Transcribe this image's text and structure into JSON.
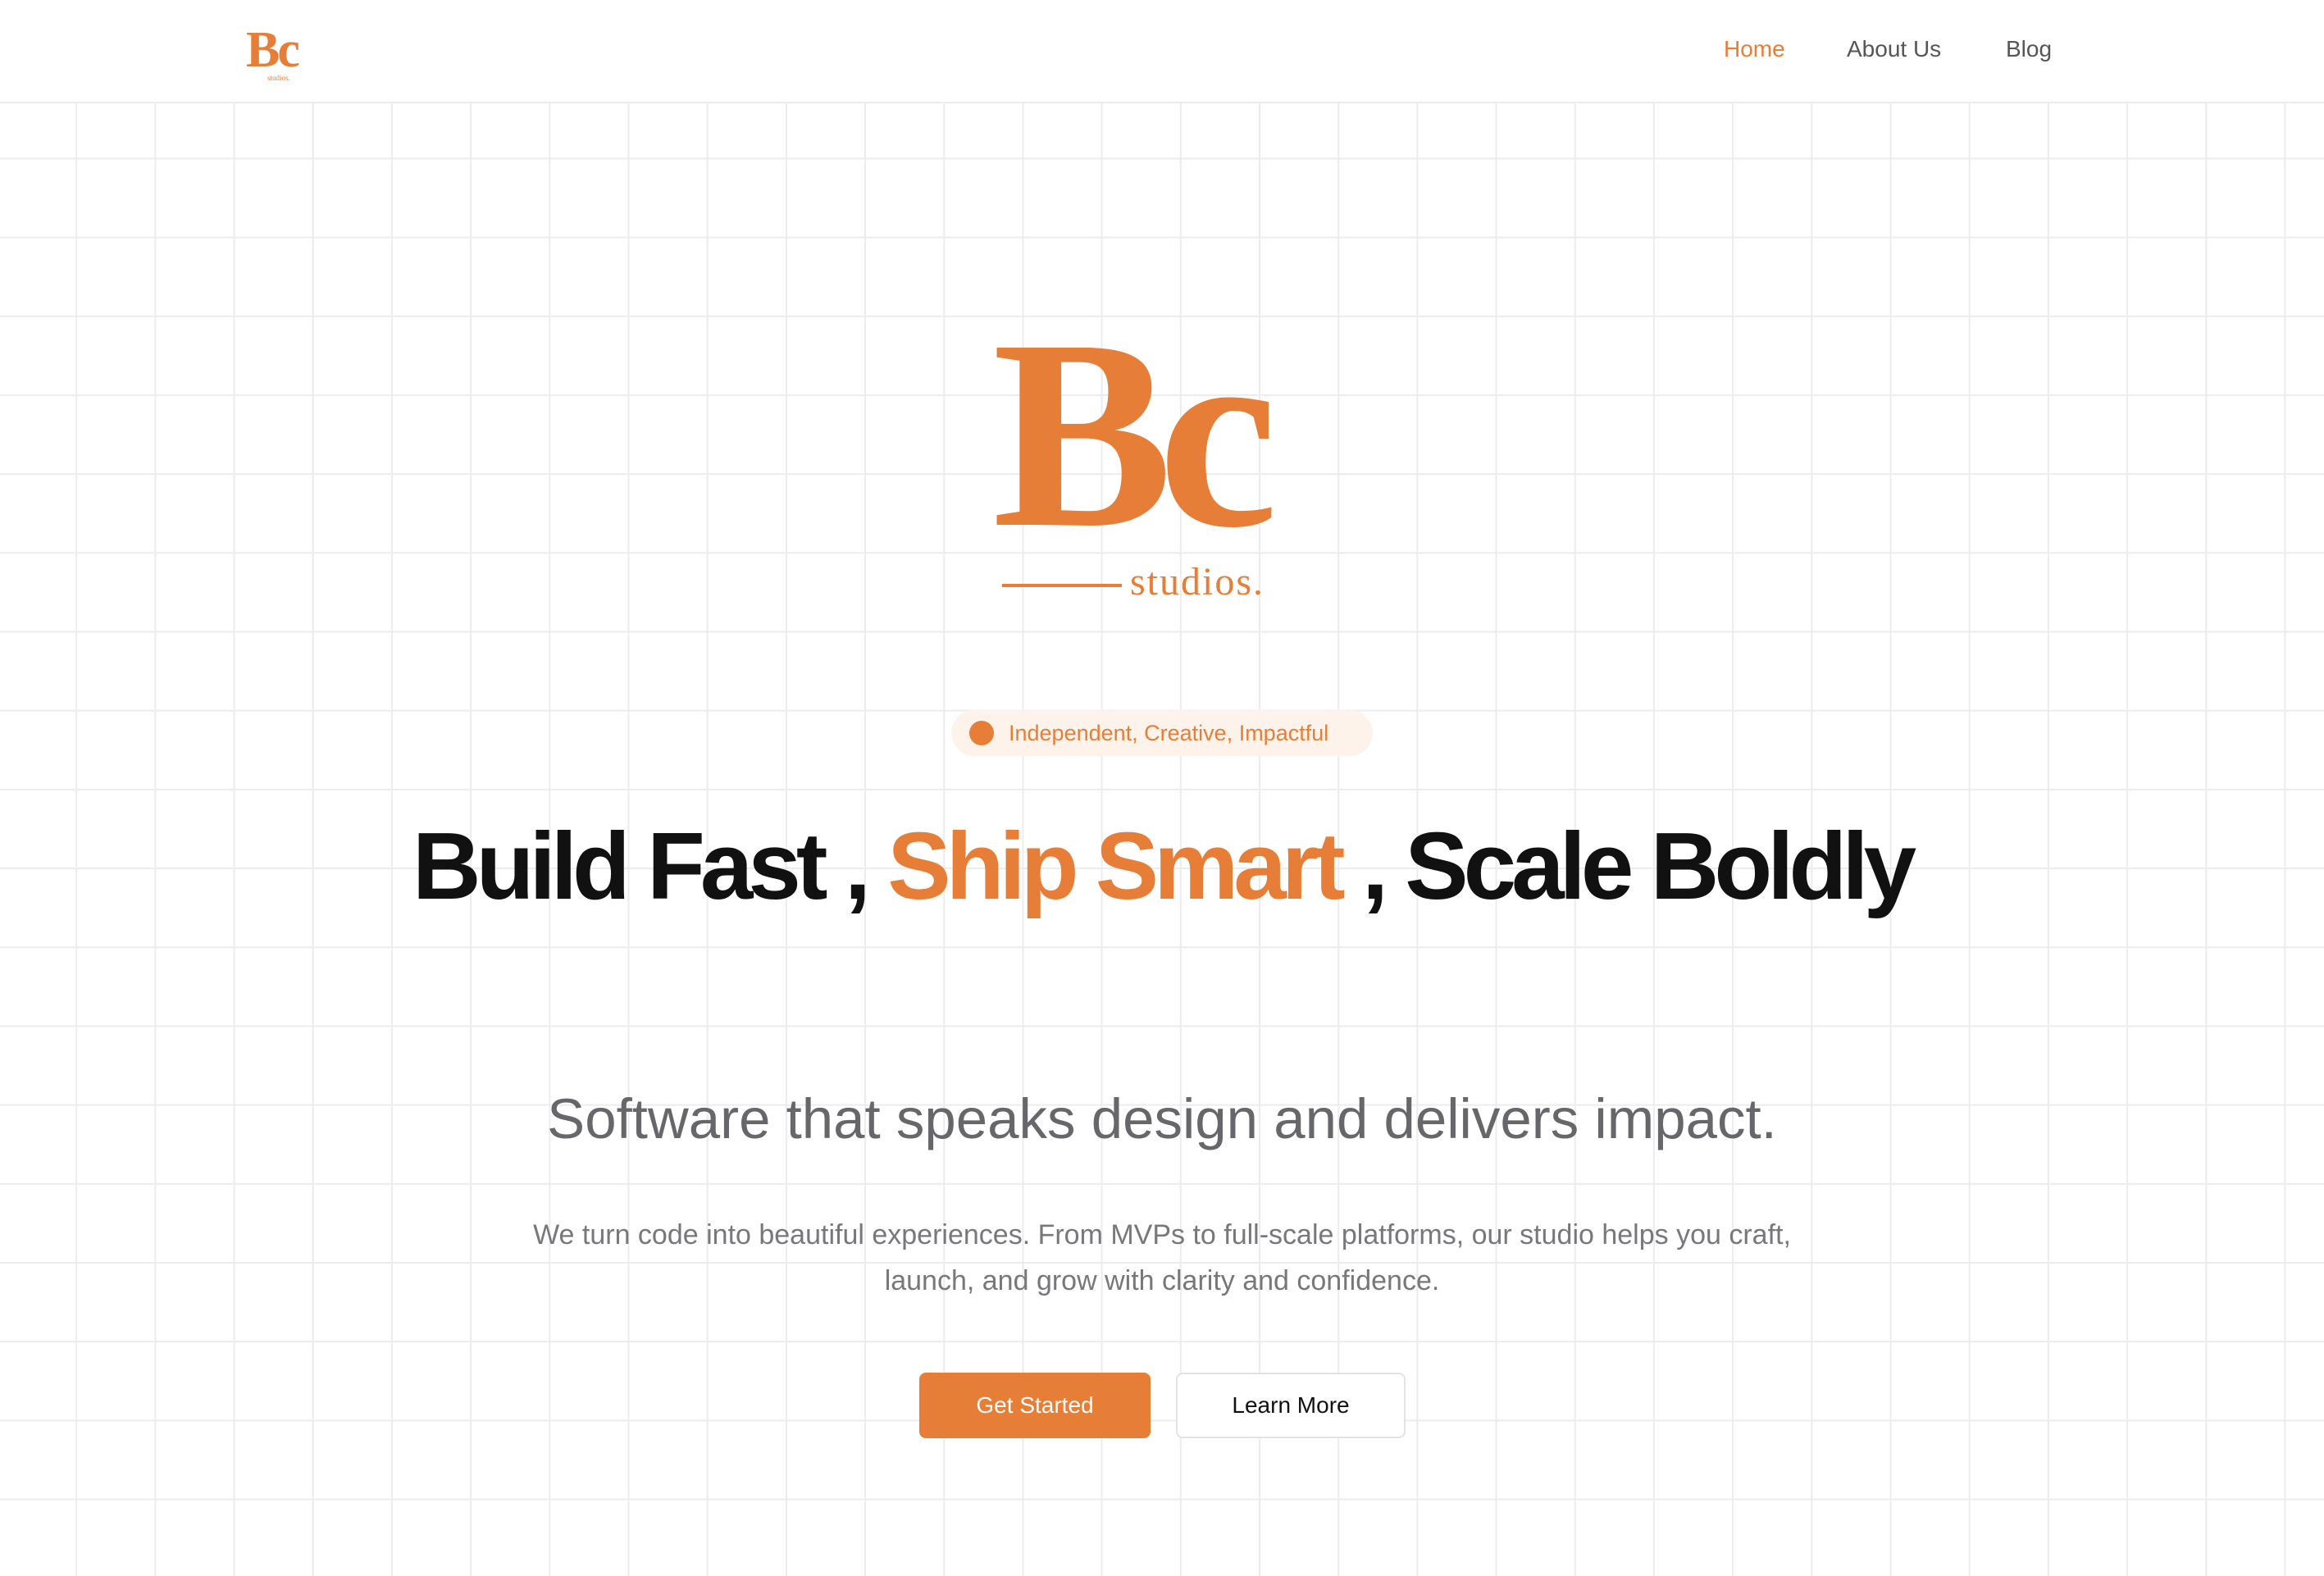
{
  "brand": {
    "logo_mark": "Bc",
    "logo_sub": "studios.",
    "accent_color": "#e77e38",
    "text_color": "#111111"
  },
  "nav": {
    "items": [
      {
        "label": "Home",
        "active": true
      },
      {
        "label": "About Us",
        "active": false
      },
      {
        "label": "Blog",
        "active": false
      }
    ]
  },
  "hero": {
    "badge": {
      "icon": "dot-icon",
      "text": "Independent, Creative, Impactful"
    },
    "headline": {
      "part1": "Build Fast",
      "sep1": " , ",
      "part2": "Ship Smart",
      "sep2": " , ",
      "part3": "Scale Boldly"
    },
    "subheadline": "Software that speaks design and delivers impact.",
    "description": "We turn code into beautiful experiences. From MVPs to full-scale platforms, our studio helps you craft, launch, and grow with clarity and confidence.",
    "buttons": {
      "primary_label": "Get Started",
      "secondary_label": "Learn More"
    }
  }
}
